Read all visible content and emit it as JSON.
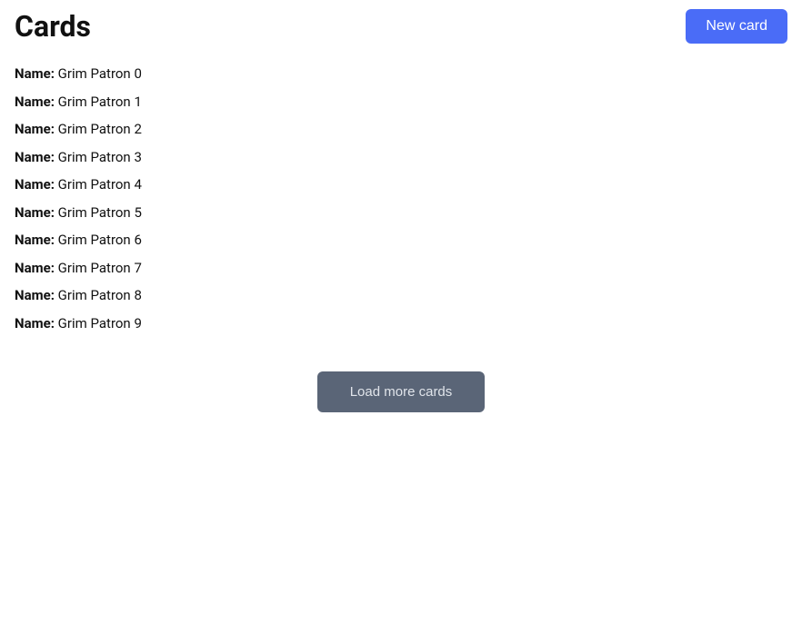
{
  "header": {
    "title": "Cards",
    "new_card_label": "New card"
  },
  "cards": [
    {
      "label": "Name:",
      "value": "Grim Patron 0"
    },
    {
      "label": "Name:",
      "value": "Grim Patron 1"
    },
    {
      "label": "Name:",
      "value": "Grim Patron 2"
    },
    {
      "label": "Name:",
      "value": "Grim Patron 3"
    },
    {
      "label": "Name:",
      "value": "Grim Patron 4"
    },
    {
      "label": "Name:",
      "value": "Grim Patron 5"
    },
    {
      "label": "Name:",
      "value": "Grim Patron 6"
    },
    {
      "label": "Name:",
      "value": "Grim Patron 7"
    },
    {
      "label": "Name:",
      "value": "Grim Patron 8"
    },
    {
      "label": "Name:",
      "value": "Grim Patron 9"
    }
  ],
  "load_more_label": "Load more cards"
}
